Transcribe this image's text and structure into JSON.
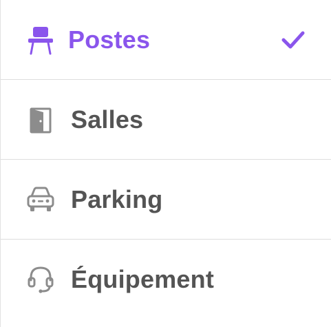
{
  "menu": {
    "items": [
      {
        "label": "Postes",
        "icon": "desk-chair-icon",
        "selected": true
      },
      {
        "label": "Salles",
        "icon": "door-icon",
        "selected": false
      },
      {
        "label": "Parking",
        "icon": "car-icon",
        "selected": false
      },
      {
        "label": "Équipement",
        "icon": "headset-icon",
        "selected": false
      }
    ],
    "selected_icon": "checkmark-icon"
  },
  "colors": {
    "accent": "#8a55ec",
    "text": "#545454",
    "icon_gray": "#8c8c8c",
    "divider": "#dddddd"
  }
}
